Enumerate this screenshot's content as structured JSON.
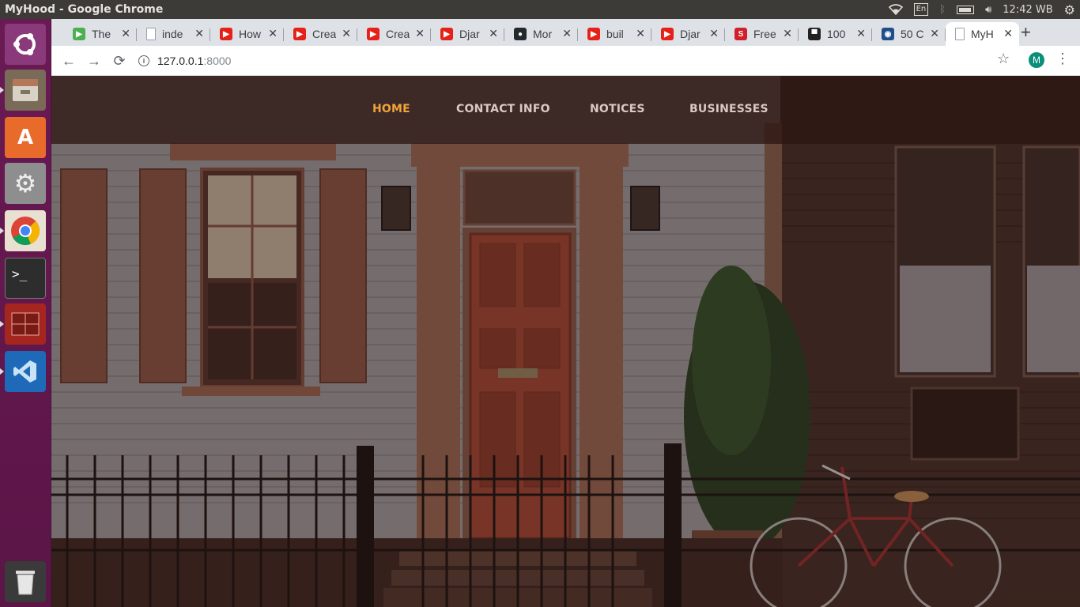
{
  "os": {
    "window_title": "MyHood - Google Chrome",
    "keyboard_layout": "En",
    "clock": "12:42 WB"
  },
  "launcher": {
    "items": [
      {
        "name": "ubuntu-dash-icon",
        "color": "#8a3a7a"
      },
      {
        "name": "files-icon",
        "color": "#7a6a58"
      },
      {
        "name": "software-center-icon",
        "color": "#e96b2b"
      },
      {
        "name": "system-settings-icon",
        "color": "#9a9a9a"
      },
      {
        "name": "chrome-icon",
        "color": "#e8e0d0"
      },
      {
        "name": "terminal-icon",
        "color": "#2d2d2d"
      },
      {
        "name": "terminator-icon",
        "color": "#a5261f"
      },
      {
        "name": "vscode-icon",
        "color": "#1e6ab8"
      },
      {
        "name": "trash-icon",
        "color": "#bdbdbd"
      }
    ]
  },
  "browser": {
    "tabs": [
      {
        "label": "The",
        "icon": "play-icon",
        "color": "#4caf50"
      },
      {
        "label": "inde",
        "icon": "page-icon",
        "color": "#9aa0a6"
      },
      {
        "label": "How",
        "icon": "youtube-icon",
        "color": "#e62117"
      },
      {
        "label": "Crea",
        "icon": "youtube-icon",
        "color": "#e62117"
      },
      {
        "label": "Crea",
        "icon": "youtube-icon",
        "color": "#e62117"
      },
      {
        "label": "Djar",
        "icon": "youtube-icon",
        "color": "#e62117"
      },
      {
        "label": "Mor",
        "icon": "github-icon",
        "color": "#24292e"
      },
      {
        "label": "buil",
        "icon": "youtube-icon",
        "color": "#e62117"
      },
      {
        "label": "Djar",
        "icon": "youtube-icon",
        "color": "#e62117"
      },
      {
        "label": "Free",
        "icon": "s-icon",
        "color": "#d1202b"
      },
      {
        "label": "100",
        "icon": "box-icon",
        "color": "#222222"
      },
      {
        "label": "50 C",
        "icon": "globe-icon",
        "color": "#1f4e8c"
      },
      {
        "label": "MyH",
        "icon": "page-icon",
        "color": "#9aa0a6",
        "active": true
      }
    ],
    "url_host": "127.0.0.1",
    "url_port": ":8000",
    "profile_initial": "M"
  },
  "site": {
    "nav": [
      {
        "label": "HOME",
        "active": true
      },
      {
        "label": "CONTACT INFO",
        "active": false
      },
      {
        "label": "NOTICES",
        "active": false
      },
      {
        "label": "BUSINESSES",
        "active": false
      }
    ],
    "accent_color": "#f0a43a"
  }
}
